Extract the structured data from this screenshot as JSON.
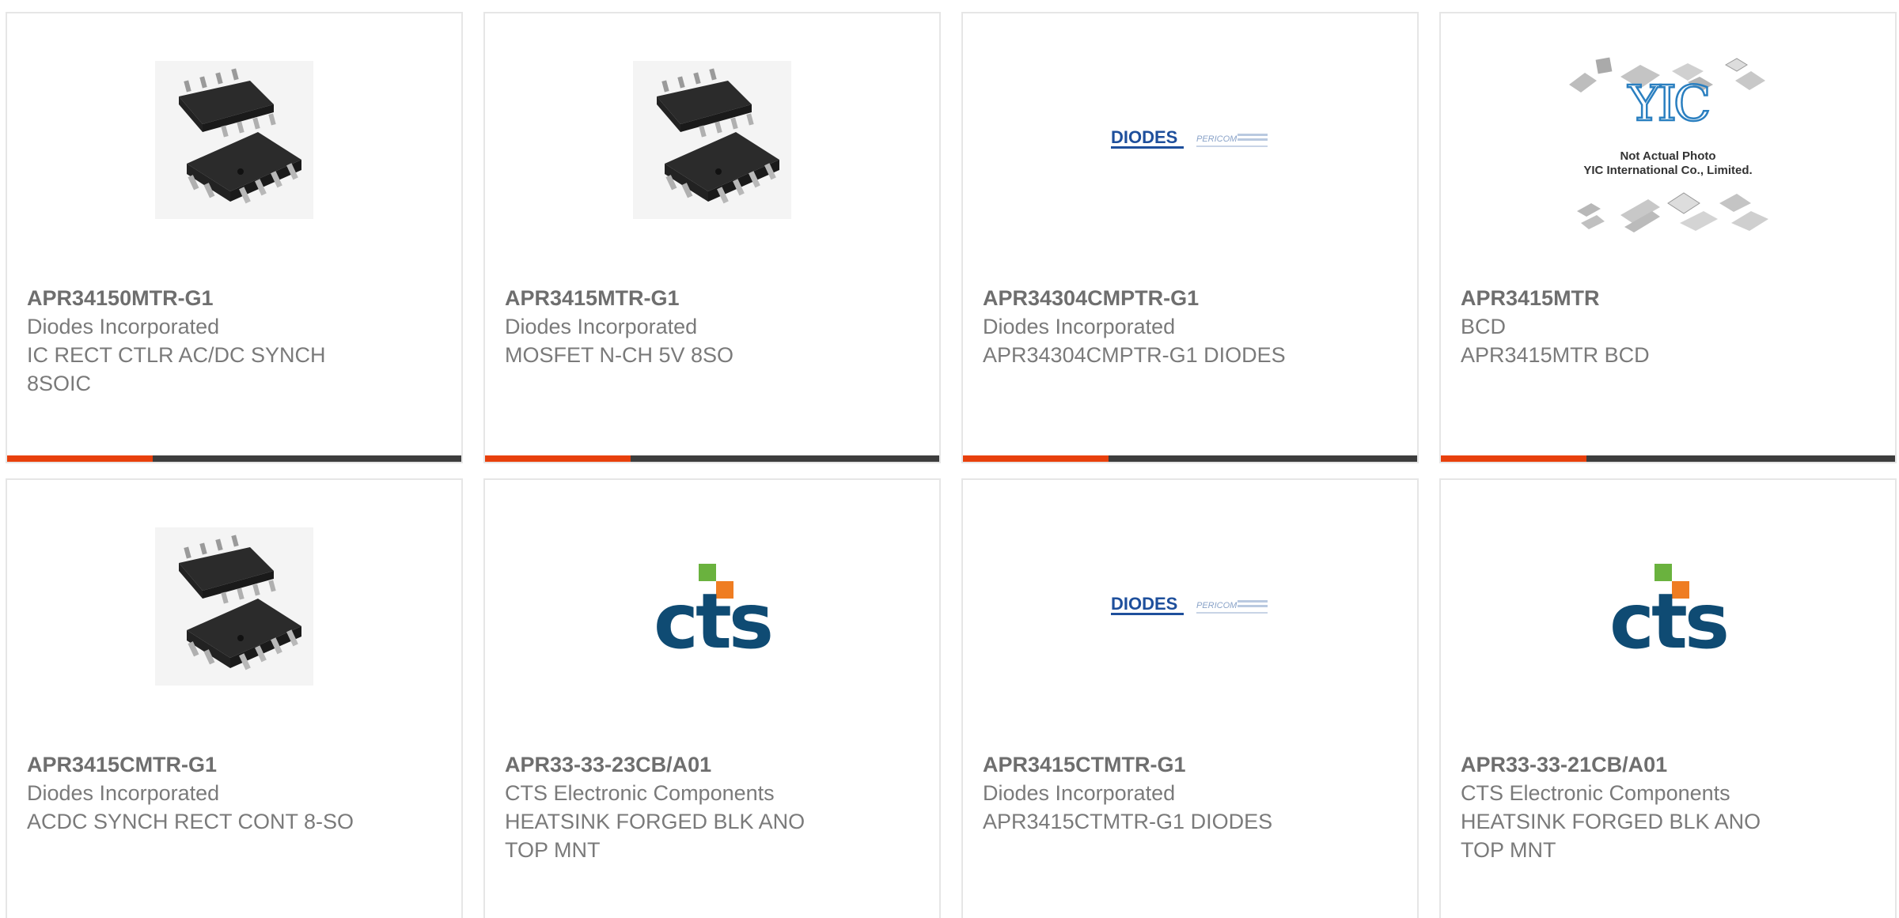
{
  "colors": {
    "text": "#7a7a7a",
    "accent": "#e8400c",
    "bar_dark": "#3d3d3d",
    "border": "#e6e6e6",
    "cts_blue": "#0f4b73",
    "cts_green": "#6ab23e",
    "cts_orange": "#ef7d22",
    "diodes_blue": "#1e4f9c"
  },
  "products": [
    {
      "part_number": "APR34150MTR-G1",
      "manufacturer": "Diodes Incorporated",
      "description": "IC RECT CTLR AC/DC SYNCH 8SOIC",
      "image": "soic-8-package-icon"
    },
    {
      "part_number": "APR3415MTR-G1",
      "manufacturer": "Diodes Incorporated",
      "description": "MOSFET N-CH 5V 8SO",
      "image": "soic-8-package-icon"
    },
    {
      "part_number": "APR34304CMPTR-G1",
      "manufacturer": "Diodes Incorporated",
      "description": "APR34304CMPTR-G1 DIODES",
      "image": "diodes-pericom-logo"
    },
    {
      "part_number": "APR3415MTR",
      "manufacturer": "BCD",
      "description": "APR3415MTR BCD",
      "image": "yic-placeholder",
      "image_text": {
        "line1": "Not Actual Photo",
        "line2": "YIC International Co., Limited.",
        "brand": "YIC"
      }
    },
    {
      "part_number": "APR3415CMTR-G1",
      "manufacturer": "Diodes Incorporated",
      "description": "ACDC SYNCH RECT CONT 8-SO",
      "image": "soic-8-package-icon"
    },
    {
      "part_number": "APR33-33-23CB/A01",
      "manufacturer": "CTS Electronic Components",
      "description": "HEATSINK FORGED BLK ANO TOP MNT",
      "image": "cts-logo"
    },
    {
      "part_number": "APR3415CTMTR-G1",
      "manufacturer": "Diodes Incorporated",
      "description": "APR3415CTMTR-G1 DIODES",
      "image": "diodes-pericom-logo"
    },
    {
      "part_number": "APR33-33-21CB/A01",
      "manufacturer": "CTS Electronic Components",
      "description": "HEATSINK FORGED BLK ANO TOP MNT",
      "image": "cts-logo"
    }
  ],
  "logos": {
    "diodes": "DIODES",
    "pericom": "PERICOM",
    "cts": "cts"
  }
}
